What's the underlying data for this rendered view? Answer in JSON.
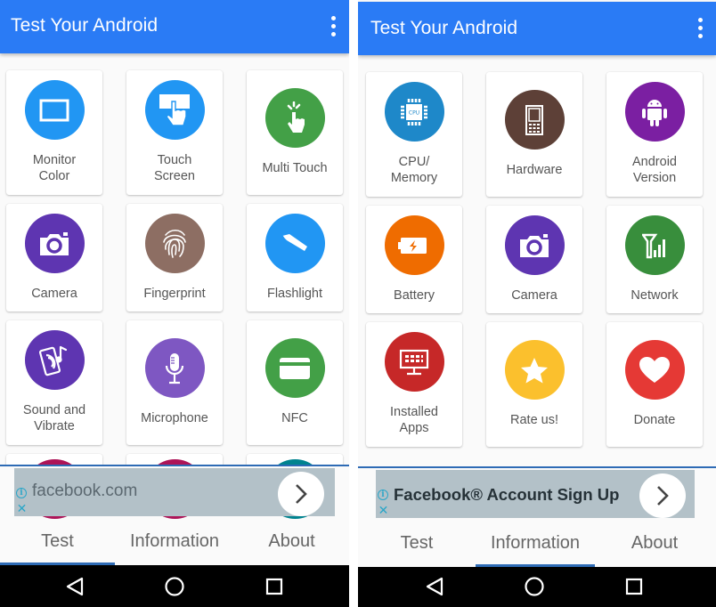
{
  "screens": [
    {
      "app_title": "Test Your Android",
      "menu_icon": "more-vert-icon",
      "tiles": [
        {
          "label": "Monitor\nColor",
          "icon": "monitor-icon",
          "color": "#2196f3"
        },
        {
          "label": "Touch\nScreen",
          "icon": "touch-screen-icon",
          "color": "#2196f3"
        },
        {
          "label": "Multi Touch",
          "icon": "multi-touch-icon",
          "color": "#43a047"
        },
        {
          "label": "Camera",
          "icon": "camera-icon",
          "color": "#5e35b1"
        },
        {
          "label": "Fingerprint",
          "icon": "fingerprint-icon",
          "color": "#8d6e63"
        },
        {
          "label": "Flashlight",
          "icon": "flashlight-icon",
          "color": "#2196f3"
        },
        {
          "label": "Sound and\nVibrate",
          "icon": "sound-vibrate-icon",
          "color": "#5e35b1"
        },
        {
          "label": "Microphone",
          "icon": "microphone-icon",
          "color": "#7e57c2"
        },
        {
          "label": "NFC",
          "icon": "nfc-icon",
          "color": "#43a047"
        }
      ],
      "partial_tiles": [
        {
          "color": "#ad1457"
        },
        {
          "color": "#ad1457"
        },
        {
          "color": "#00838f"
        }
      ],
      "ad": {
        "text": "facebook.com",
        "info_icon": "ad-info-icon",
        "close_icon": "ad-close-icon",
        "go_icon": "chevron-right-icon"
      },
      "tabs": [
        {
          "label": "Test",
          "active": true
        },
        {
          "label": "Information",
          "active": false
        },
        {
          "label": "About",
          "active": false
        }
      ]
    },
    {
      "app_title": "Test Your Android",
      "menu_icon": "more-vert-icon",
      "tiles": [
        {
          "label": "CPU/\nMemory",
          "icon": "cpu-icon",
          "color": "#1e88c9",
          "icon_text": "CPU"
        },
        {
          "label": "Hardware",
          "icon": "hardware-phone-icon",
          "color": "#5d4037"
        },
        {
          "label": "Android\nVersion",
          "icon": "android-icon",
          "color": "#7b1fa2"
        },
        {
          "label": "Battery",
          "icon": "battery-charging-icon",
          "color": "#ef6c00"
        },
        {
          "label": "Camera",
          "icon": "camera-icon",
          "color": "#5e35b1"
        },
        {
          "label": "Network",
          "icon": "network-signal-icon",
          "color": "#388e3c"
        },
        {
          "label": "Installed\nApps",
          "icon": "installed-apps-icon",
          "color": "#c62828"
        },
        {
          "label": "Rate us!",
          "icon": "star-icon",
          "color": "#fbc02d"
        },
        {
          "label": "Donate",
          "icon": "heart-icon",
          "color": "#e53935"
        }
      ],
      "ad": {
        "text": "Facebook® Account Sign Up",
        "info_icon": "ad-info-icon",
        "close_icon": "ad-close-icon",
        "go_icon": "chevron-right-icon"
      },
      "tabs": [
        {
          "label": "Test",
          "active": false
        },
        {
          "label": "Information",
          "active": true
        },
        {
          "label": "About",
          "active": false
        }
      ]
    }
  ],
  "system_nav": {
    "back": "back-icon",
    "home": "home-icon",
    "recents": "recents-icon"
  }
}
